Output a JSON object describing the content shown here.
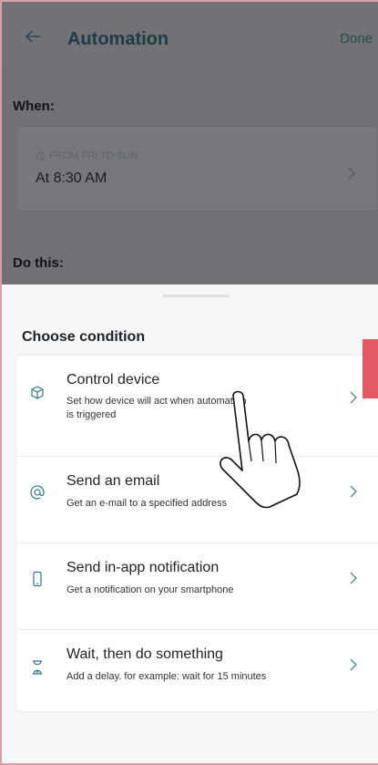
{
  "header": {
    "title": "Automation",
    "done_label": "Done",
    "back_icon": "back-arrow-icon"
  },
  "when": {
    "label": "When:",
    "caption": "FROM FRI TO SUN",
    "time": "At 8:30 AM"
  },
  "do_this": {
    "label": "Do this:"
  },
  "sheet": {
    "title": "Choose condition",
    "items": [
      {
        "title": "Control device",
        "subtitle": "Set how device will act when automation is triggered",
        "icon": "cube-icon"
      },
      {
        "title": "Send an email",
        "subtitle": "Get an e-mail to a specified address",
        "icon": "at-icon"
      },
      {
        "title": "Send in-app notification",
        "subtitle": "Get a notification on your smartphone",
        "icon": "phone-icon"
      },
      {
        "title": "Wait, then do something",
        "subtitle": "Add a delay. for example: wait for 15 minutes",
        "icon": "hourglass-icon"
      }
    ]
  },
  "colors": {
    "accent": "#1f3b47",
    "icon_teal": "#2d7a8a",
    "overlay": "#6f7174",
    "marker_red": "#e35a66"
  }
}
